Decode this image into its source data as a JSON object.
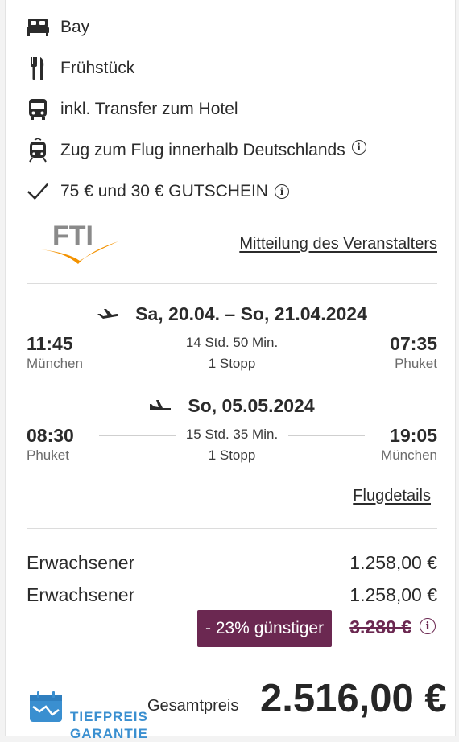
{
  "features": [
    {
      "icon": "bed-icon",
      "label": "Bay"
    },
    {
      "icon": "cutlery-icon",
      "label": "Frühstück"
    },
    {
      "icon": "bus-icon",
      "label": "inkl. Transfer zum Hotel"
    },
    {
      "icon": "train-icon",
      "label": "Zug zum Flug innerhalb Deutschlands"
    },
    {
      "icon": "checkmark-icon",
      "label": "75 € und 30 € GUTSCHEIN"
    }
  ],
  "operator": {
    "logo_text": "FTI",
    "link_label": "Mitteilung des Veranstalters"
  },
  "outbound": {
    "date": "Sa, 20.04. – So, 21.04.2024",
    "dep_time": "11:45",
    "dep_place": "München",
    "duration": "14 Std. 50 Min.",
    "stops": "1 Stopp",
    "arr_time": "07:35",
    "arr_place": "Phuket"
  },
  "return": {
    "date": "So, 05.05.2024",
    "dep_time": "08:30",
    "dep_place": "Phuket",
    "duration": "15 Std. 35 Min.",
    "stops": "1 Stopp",
    "arr_time": "19:05",
    "arr_place": "München"
  },
  "flight_details_label": "Flugdetails",
  "prices": [
    {
      "label": "Erwachsener",
      "value": "1.258,00 €"
    },
    {
      "label": "Erwachsener",
      "value": "1.258,00 €"
    }
  ],
  "discount": {
    "badge": "- 23% günstiger",
    "old_price": "3.280 €"
  },
  "total": {
    "badge_line1": "TIEFPREIS",
    "badge_line2": "GARANTIE",
    "label": "Gesamtpreis",
    "value": "2.516,00 €"
  },
  "colors": {
    "accent": "#6b2851",
    "badge_blue": "#3a8fd0",
    "fti_orange": "#f39200"
  }
}
